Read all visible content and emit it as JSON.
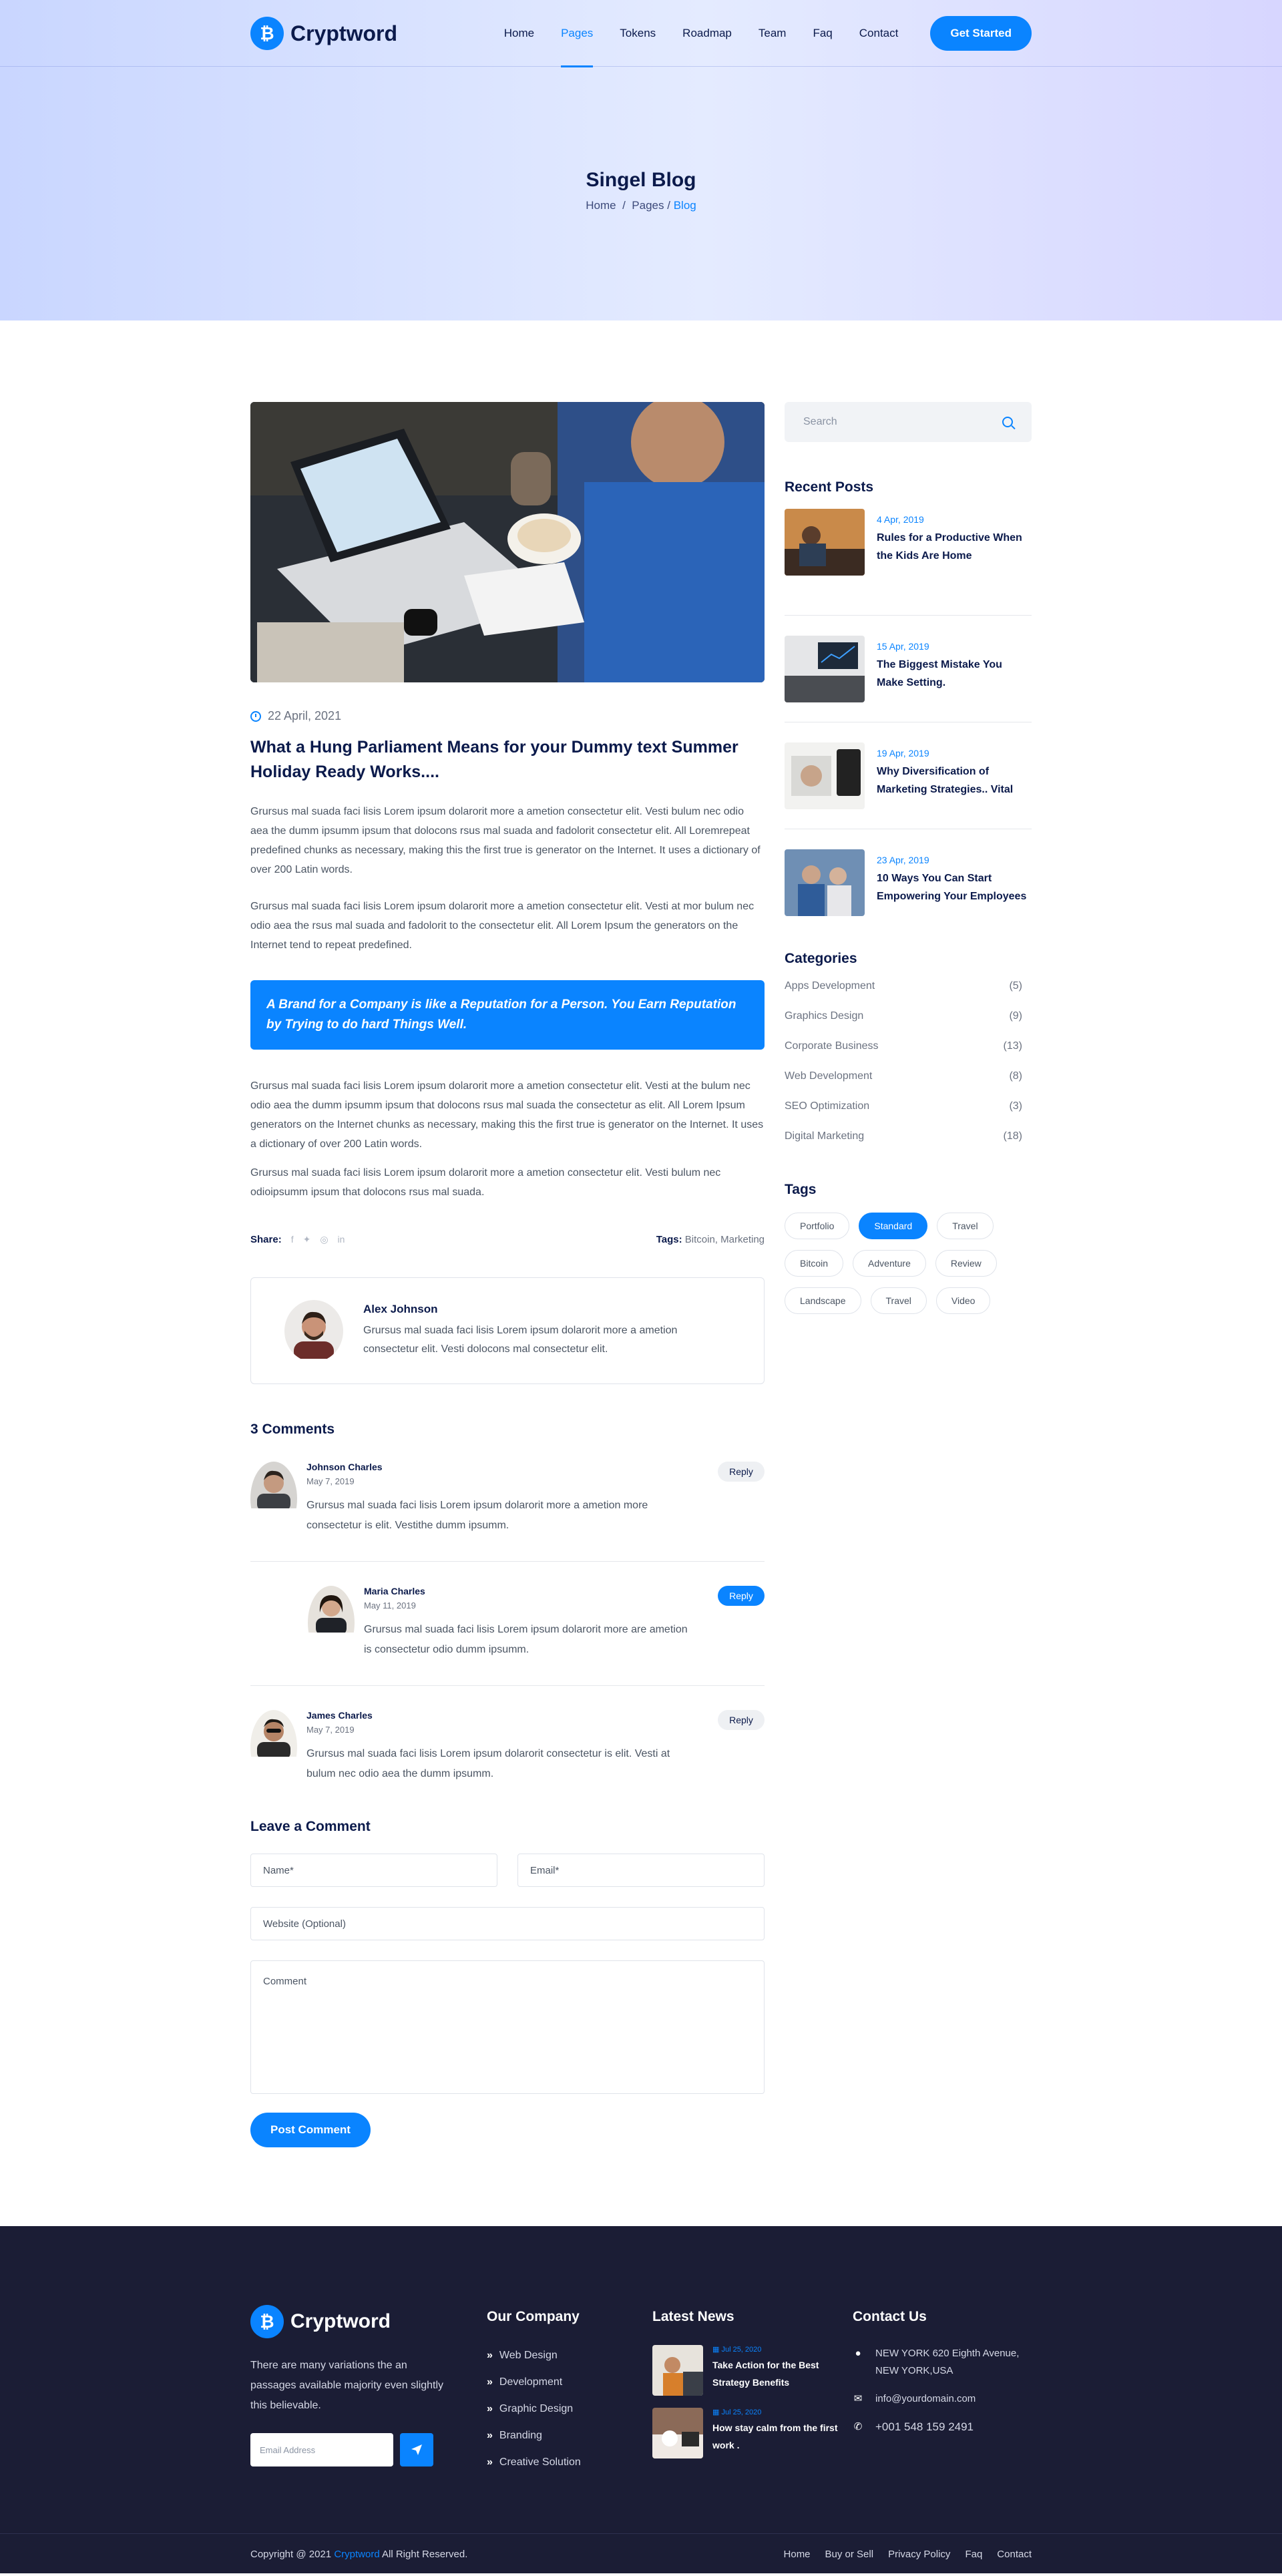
{
  "brand": {
    "name": "Cryptword",
    "accent": "#0a84ff",
    "navy": "#0b1a4b"
  },
  "nav": {
    "items": [
      "Home",
      "Pages",
      "Tokens",
      "Roadmap",
      "Team",
      "Faq",
      "Contact"
    ],
    "active": "Pages",
    "cta": "Get Started"
  },
  "hero": {
    "title": "Singel Blog",
    "breadcrumb": {
      "home": "Home",
      "sep": "/",
      "pages": "Pages",
      "current": "Blog"
    }
  },
  "post": {
    "date": "22 April, 2021",
    "title": "What a Hung Parliament Means for your Dummy text Summer Holiday Ready Works....",
    "paragraphs": [
      "Grursus mal suada faci lisis Lorem ipsum dolarorit more a ametion consectetur elit. Vesti bulum nec odio aea the dumm ipsumm ipsum that dolocons rsus mal suada and fadolorit consectetur elit. All Loremrepeat predefined chunks as necessary, making this the first true is generator on the Internet. It uses a dictionary of over 200 Latin words.",
      "Grursus mal suada faci lisis Lorem ipsum dolarorit more a ametion consectetur elit. Vesti at mor bulum nec odio aea the rsus mal suada and fadolorit to the consectetur elit. All Lorem Ipsum the generators on the Internet tend to repeat predefined.",
      "Grursus mal suada faci lisis Lorem ipsum dolarorit more a ametion consectetur elit. Vesti at the bulum nec odio aea the dumm ipsumm ipsum that dolocons rsus mal suada the consectetur as elit. All Lorem Ipsum generators on the Internet chunks as necessary, making this the first true is generator on the Internet. It uses a dictionary of over 200 Latin words.",
      "Grursus mal suada faci lisis Lorem ipsum dolarorit more a ametion consectetur elit. Vesti bulum nec odioipsumm ipsum that dolocons rsus mal suada."
    ],
    "quote": "A Brand for a Company is like a Reputation for a Person. You Earn Reputation by Trying to do hard Things Well.",
    "share_label": "Share:",
    "share_icons": [
      "facebook-icon",
      "twitter-icon",
      "instagram-icon",
      "linkedin-icon"
    ],
    "tags_label": "Tags:",
    "tags_value": "Bitcoin, Marketing"
  },
  "author": {
    "name": "Alex Johnson",
    "bio": "Grursus mal suada faci lisis Lorem ipsum dolarorit more a ametion consectetur elit. Vesti dolocons mal consectetur elit."
  },
  "comments": {
    "title": "3 Comments",
    "items": [
      {
        "name": "Johnson Charles",
        "date": "May 7, 2019",
        "text": "Grursus mal suada faci lisis Lorem ipsum dolarorit more a ametion more consectetur is elit. Vestithe dumm ipsumm.",
        "reply": "Reply"
      },
      {
        "name": "Maria Charles",
        "date": "May 11, 2019",
        "text": "Grursus mal suada faci lisis Lorem ipsum dolarorit more are ametion is consectetur odio dumm ipsumm.",
        "reply": "Reply"
      },
      {
        "name": "James Charles",
        "date": "May 7, 2019",
        "text": "Grursus mal suada faci lisis Lorem ipsum dolarorit consectetur is elit. Vesti at bulum nec odio aea the dumm ipsumm.",
        "reply": "Reply"
      }
    ]
  },
  "form": {
    "title": "Leave a Comment",
    "name_placeholder": "Name*",
    "email_placeholder": "Email*",
    "website_placeholder": "Website (Optional)",
    "comment_placeholder": "Comment",
    "submit": "Post Comment"
  },
  "sidebar": {
    "search_placeholder": "Search",
    "recent_title": "Recent Posts",
    "recent": [
      {
        "date": "4 Apr, 2019",
        "title": "Rules for a Productive When the Kids Are Home"
      },
      {
        "date": "15 Apr, 2019",
        "title": "The Biggest Mistake You Make Setting."
      },
      {
        "date": "19 Apr, 2019",
        "title": "Why Diversification of Marketing Strategies.. Vital"
      },
      {
        "date": "23 Apr, 2019",
        "title": "10 Ways You Can Start Empowering Your Employees"
      }
    ],
    "categories_title": "Categories",
    "categories": [
      {
        "name": "Apps Development",
        "count": "(5)"
      },
      {
        "name": "Graphics Design",
        "count": "(9)"
      },
      {
        "name": "Corporate Business",
        "count": "(13)"
      },
      {
        "name": "Web Development",
        "count": "(8)"
      },
      {
        "name": "SEO Optimization",
        "count": "(3)"
      },
      {
        "name": "Digital Marketing",
        "count": "(18)"
      }
    ],
    "tags_title": "Tags",
    "tags": [
      "Portfolio",
      "Standard",
      "Travel",
      "Bitcoin",
      "Adventure",
      "Review",
      "Landscape",
      "Travel",
      "Video"
    ],
    "active_tag": "Standard"
  },
  "footer": {
    "description": "There are many variations the an passages available majority even slightly this believable.",
    "email_placeholder": "Email Address",
    "company_title": "Our Company",
    "company_links": [
      "Web Design",
      "Development",
      "Graphic Design",
      "Branding",
      "Creative Solution"
    ],
    "news_title": "Latest News",
    "news": [
      {
        "date": "Jul 25, 2020",
        "title": "Take Action for the Best Strategy Benefits"
      },
      {
        "date": "Jul 25, 2020",
        "title": "How stay calm from the first work ."
      }
    ],
    "contact_title": "Contact Us",
    "address": "NEW YORK 620 Eighth Avenue, NEW YORK,USA",
    "email": "info@yourdomain.com",
    "phone": "+001 548 159 2491",
    "copyright_prefix": "Copyright @ 2021",
    "copyright_brand": "Cryptword",
    "copyright_suffix": "All Right Reserved.",
    "bottom_links": [
      "Home",
      "Buy or Sell",
      "Privacy Policy",
      "Faq",
      "Contact"
    ]
  }
}
